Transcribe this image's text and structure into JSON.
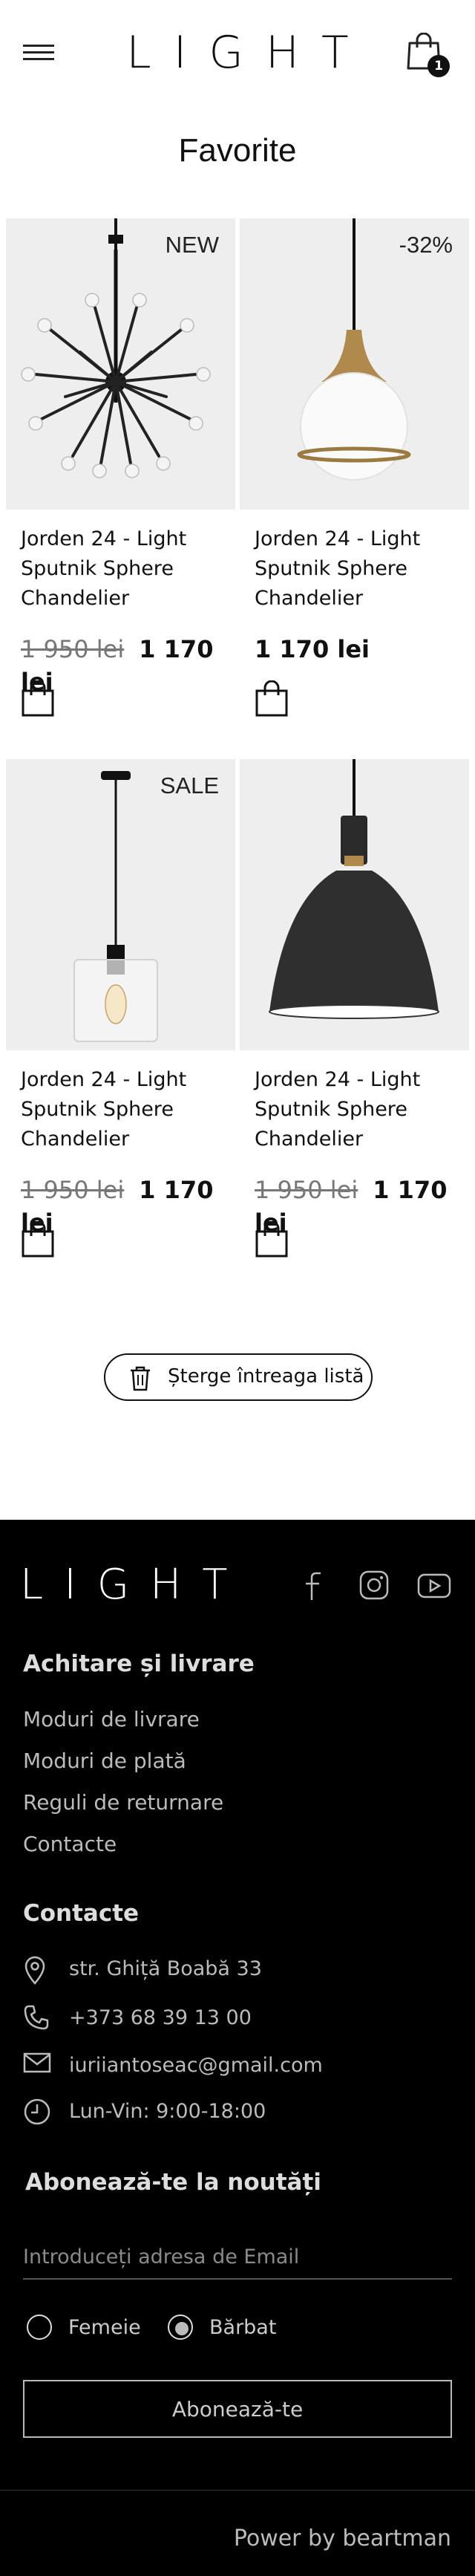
{
  "header": {
    "logo": "LIGHT",
    "cart_count": "1"
  },
  "page": {
    "title": "Favorite"
  },
  "products": [
    {
      "badge": "NEW",
      "name": "Jorden 24 - Light Sputnik Sphere Chandelier",
      "old_price": "1 950 lei",
      "price": "1 170 lei",
      "image": "sputnik-chandelier"
    },
    {
      "badge": "-32%",
      "name": "Jorden 24 - Light Sputnik Sphere Chandelier",
      "old_price": "",
      "price": "1 170 lei",
      "image": "globe-pendant"
    },
    {
      "badge": "SALE",
      "name": "Jorden 24 - Light Sputnik Sphere Chandelier",
      "old_price": "1 950 lei",
      "price": "1 170 lei",
      "image": "glass-cylinder-pendant"
    },
    {
      "badge": "",
      "name": "Jorden 24 - Light Sputnik Sphere Chandelier",
      "old_price": "1 950 lei",
      "price": "1 170 lei",
      "image": "dome-pendant"
    }
  ],
  "actions": {
    "clear_list": "Șterge întreaga listă"
  },
  "footer": {
    "logo": "LIGHT",
    "payment_heading": "Achitare și livrare",
    "payment_links": [
      "Moduri de livrare",
      "Moduri de plată",
      "Reguli de returnare",
      "Contacte"
    ],
    "contacts_heading": "Contacte",
    "address": "str. Ghiță Boabă 33",
    "phone": "+373 68 39 13 00",
    "email": "iuriiantoseac@gmail.com",
    "hours": "Lun-Vin: 9:00-18:00",
    "newsletter_heading": "Abonează-te la noutăți",
    "email_placeholder": "Introduceți adresa de Email",
    "gender_female": "Femeie",
    "gender_male": "Bărbat",
    "selected_gender": "Bărbat",
    "subscribe_label": "Abonează-te",
    "credit": "Power by beartman"
  }
}
